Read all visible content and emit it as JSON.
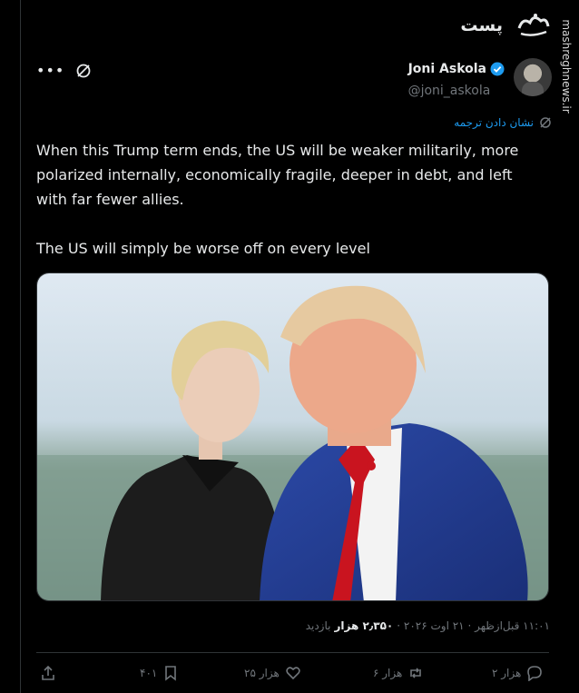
{
  "header": {
    "title": "پست",
    "logo_text": "مشرق"
  },
  "watermark": "mashreghnews.ir",
  "author": {
    "display_name": "Joni Askola",
    "handle": "@joni_askola",
    "verified": true
  },
  "translate_label": "نشان دادن ترجمه",
  "tweet": {
    "paragraph1": "When this Trump term ends, the US will be weaker militarily, more polarized internally, economically fragile, deeper in debt, and left with far fewer allies.",
    "paragraph2": "The US will simply be worse off on every level"
  },
  "meta": {
    "time": "۱۱:۰۱ قبل‌ازظهر · ۲۱ اوت ۲۰۲۶ ·",
    "views": "۲٫۳۵۰ هزار",
    "views_label": "بازدید"
  },
  "actions": {
    "reply_count": "۲ هزار",
    "repost_count": "۶ هزار",
    "like_count": "۲۵ هزار",
    "bookmark_count": "۴۰۱"
  },
  "colors": {
    "background": "#000000",
    "accent": "#1d9bf0",
    "muted": "#71767b",
    "text": "#e7e9ea"
  }
}
